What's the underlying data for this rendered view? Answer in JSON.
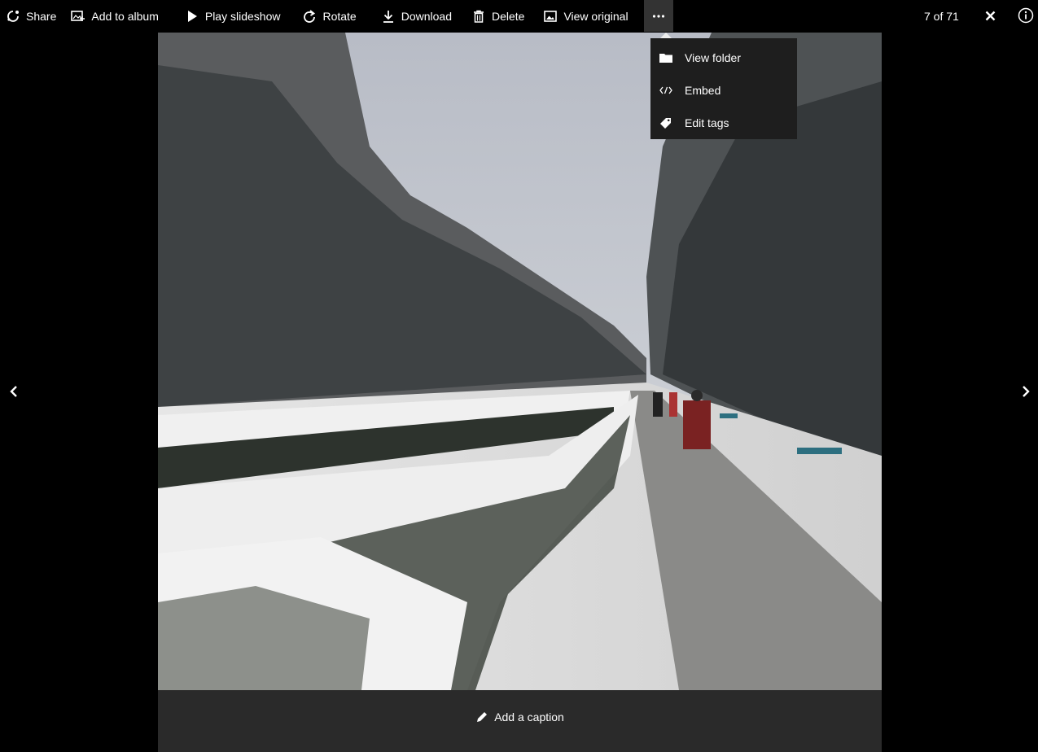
{
  "toolbar": {
    "share_label": "Share",
    "add_to_album_label": "Add to album",
    "play_slideshow_label": "Play slideshow",
    "rotate_label": "Rotate",
    "download_label": "Download",
    "delete_label": "Delete",
    "view_original_label": "View original",
    "counter": "7 of 71"
  },
  "menu": {
    "items": [
      {
        "label": "View folder",
        "icon": "folder-icon"
      },
      {
        "label": "Embed",
        "icon": "embed-code-icon"
      },
      {
        "label": "Edit tags",
        "icon": "tag-icon"
      }
    ]
  },
  "caption": {
    "add_caption_label": "Add a caption"
  },
  "colors": {
    "background": "#000000",
    "caption_bar": "#2a2a2a",
    "menu_bg": "#1e1e1e",
    "more_button_active": "#333333"
  }
}
